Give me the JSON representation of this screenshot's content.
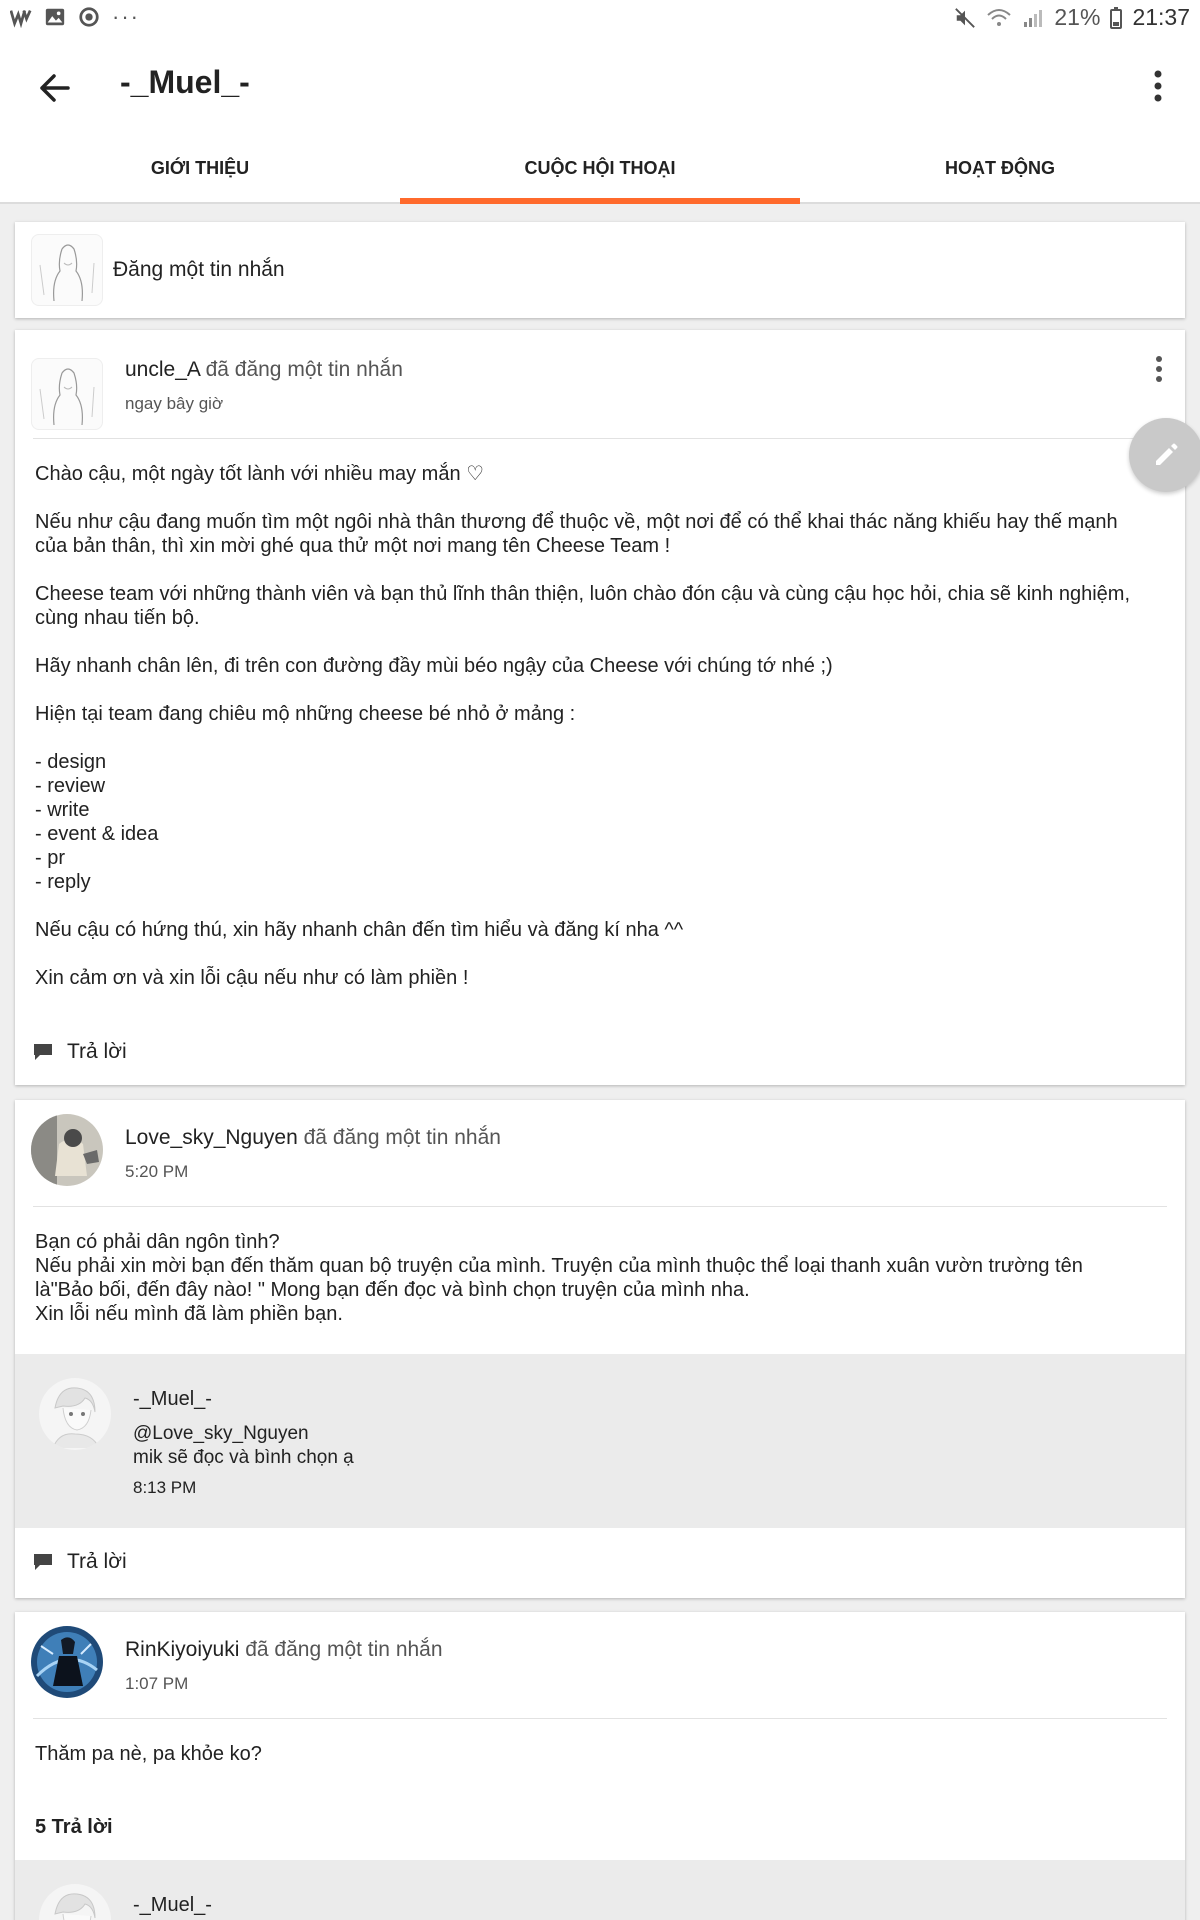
{
  "status_bar": {
    "battery": "21%",
    "time": "21:37",
    "icons_left": [
      "wattpad-icon",
      "image-icon",
      "sync-icon",
      "more-icon"
    ],
    "icons_right": [
      "mute-icon",
      "wifi-icon",
      "signal-icon",
      "battery-icon"
    ]
  },
  "header": {
    "title": "-_Muel_-"
  },
  "tabs": [
    {
      "label": "GIỚI THIỆU",
      "active": false
    },
    {
      "label": "CUỘC HỘI THOẠI",
      "active": true
    },
    {
      "label": "HOẠT ĐỘNG",
      "active": false
    }
  ],
  "composer": {
    "placeholder": "Đăng một tin nhắn"
  },
  "posts": [
    {
      "author": "uncle_A",
      "verb": "đã đăng một tin nhắn",
      "time": "ngay bây giờ",
      "body": "Chào cậu, một ngày tốt lành với nhiều may mắn ♡\n\nNếu như cậu đang muốn tìm một ngôi nhà thân thương để thuộc về, một nơi để có thể khai thác năng khiếu hay thế mạnh của bản thân, thì xin mời ghé qua thử một nơi mang tên Cheese Team !\n\nCheese team với những thành viên và bạn thủ lĩnh thân thiện, luôn chào đón cậu và cùng cậu học hỏi, chia sẽ kinh nghiệm, cùng nhau tiến bộ.\n\nHãy nhanh chân lên, đi trên con đường đầy mùi béo ngậy của Cheese với chúng tớ nhé ;)\n\nHiện tại team đang chiêu mộ những cheese bé nhỏ ở mảng :\n\n- design\n- review\n- write\n- event & idea\n- pr\n- reply\n\nNếu cậu có hứng thú, xin hãy nhanh chân đến tìm hiểu và đăng kí nha ^^\n\nXin cảm ơn và xin lỗi cậu nếu như có làm phiền !",
      "reply_label": "Trả lời"
    },
    {
      "author": "Love_sky_Nguyen",
      "verb": "đã đăng một tin nhắn",
      "time": "5:20 PM",
      "body": "Bạn có phải dân ngôn tình?\nNếu phải xin mời bạn đến thăm quan bộ truyện của mình. Truyện của mình thuộc thể loại thanh xuân vườn trường tên là\"Bảo bối, đến đây nào! \" Mong bạn đến đọc và bình chọn truyện của mình nha.\nXin lỗi nếu mình đã làm phiền bạn.",
      "reply": {
        "author": "-_Muel_-",
        "text": "@Love_sky_Nguyen\nmik sẽ đọc và bình chọn ạ",
        "time": "8:13 PM"
      },
      "reply_label": "Trả lời"
    },
    {
      "author": "RinKiyoiyuki",
      "verb": "đã đăng một tin nhắn",
      "time": "1:07 PM",
      "body": "Thăm pa nè, pa khỏe ko?",
      "reply_count": "5 Trả lời",
      "reply": {
        "author": "-_Muel_-"
      }
    }
  ],
  "colors": {
    "accent": "#ff6a2c",
    "reply_bg": "#ebebeb"
  }
}
